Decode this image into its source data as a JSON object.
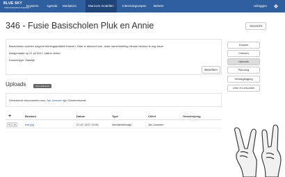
{
  "nav": {
    "logo_line1": "BLUE SKY",
    "logo_line2": "VERANDERMANAGEMENT",
    "items": [
      "Dossiers",
      "Agenda",
      "Mediators",
      "Mancom modellen",
      "Intervisiegroepen",
      "Beheer"
    ],
    "active_index": 3,
    "user_label": "Uitloggen"
  },
  "page": {
    "title": "346 - Fusie Basischolen Pluk en Annie",
    "overview_button": "Overzicht"
  },
  "info": {
    "line1": "Basischolen moeten wegens leerlingaantallen fuseren. Daar is akkoord over, maar samenstelling nieuwe bestuur is nog issue.",
    "line2": "Aangemaakt op 21 jul 2017, status: Actief",
    "line3": "Dossiertype: Zakelijk",
    "edit_button": "Bewerken"
  },
  "side_menu": {
    "items": [
      "Dossier",
      "Cliënten",
      "Uploads",
      "Planning",
      "Verslaglegging",
      "Uren en onkosten"
    ],
    "active_index": 2
  },
  "uploads": {
    "title": "Uploads",
    "badge": "Toon archieven",
    "note_prefix": "Onbekende documenten voor",
    "note_link": "Jan Janssen",
    "note_suffix": "zijn Overeenkomst."
  },
  "table": {
    "headers": [
      "Bestand",
      "Datum",
      "Type",
      "Cliënt",
      "Omschrijving"
    ],
    "add_symbol": "+",
    "rows": [
      {
        "edit": "✎",
        "delete": "✕",
        "file": "test.jpg",
        "date": "21-07-2017 13:56",
        "type": "Identiteitsbewijs",
        "client": "Jan Janssen",
        "description": ""
      }
    ]
  },
  "colors": {
    "nav_bg": "#2f5f9e",
    "nav_active": "#1f4478",
    "link": "#2f5f9e"
  }
}
